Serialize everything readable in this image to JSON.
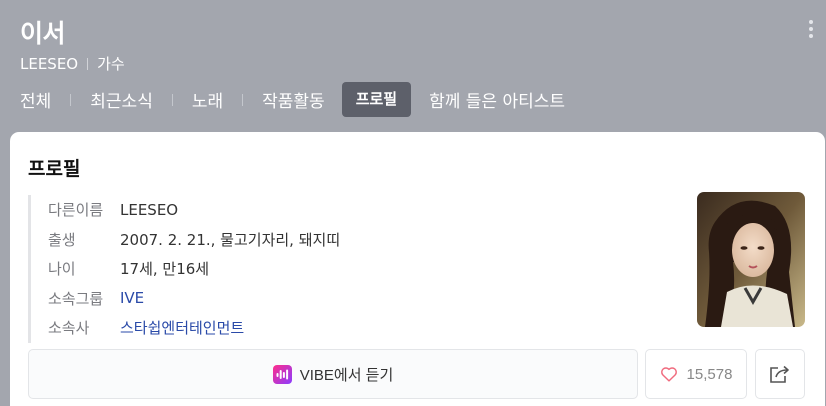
{
  "header": {
    "title": "이서",
    "english_name": "LEESEO",
    "role": "가수"
  },
  "tabs": [
    {
      "label": "전체",
      "active": false
    },
    {
      "label": "최근소식",
      "active": false
    },
    {
      "label": "노래",
      "active": false
    },
    {
      "label": "작품활동",
      "active": false
    },
    {
      "label": "프로필",
      "active": true
    },
    {
      "label": "함께 들은 아티스트",
      "active": false
    }
  ],
  "profile": {
    "title": "프로필",
    "rows": [
      {
        "key": "다른이름",
        "value": "LEESEO"
      },
      {
        "key": "출생",
        "value": "2007. 2. 21., 물고기자리, 돼지띠"
      },
      {
        "key": "나이",
        "value": "17세, 만16세"
      },
      {
        "key": "소속그룹",
        "value": "IVE"
      },
      {
        "key": "소속사",
        "value": "스타쉽엔터테인먼트"
      }
    ]
  },
  "actions": {
    "vibe_label": "VIBE에서 듣기",
    "like_count": "15,578"
  },
  "icons": {
    "more": "more-vertical-icon",
    "vibe": "vibe-logo-icon",
    "like": "heart-outline-icon",
    "share": "share-icon"
  },
  "colors": {
    "header_bg": "#a3a6ae",
    "active_tab_bg": "#5d606a",
    "link": "#2a4aa8",
    "heart": "#f06b7e"
  }
}
